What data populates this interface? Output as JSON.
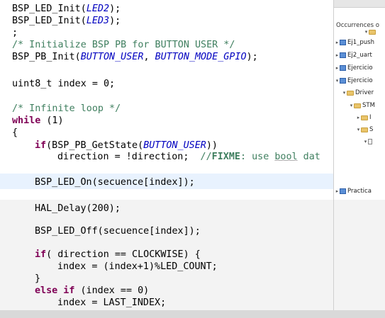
{
  "editor": {
    "lines": [
      "BSP_LED_Init(",
      "LED2",
      ");",
      "BSP_LED_Init(",
      "LED3",
      ");",
      ";",
      "/* Initialize BSP PB for BUTTON USER */",
      "BSP_PB_Init(",
      "BUTTON_USER",
      ", ",
      "BUTTON_MODE_GPIO",
      ");",
      "uint8_t index = 0;",
      "/* Infinite loop */",
      "while",
      " (1)",
      "{",
      "if",
      "(BSP_PB_GetState(",
      "BUTTON_USER",
      "))",
      "direction = !direction;  ",
      "//",
      "FIXME",
      ": use ",
      "bool",
      " dat",
      "BSP_LED_On(secuence[index]);",
      "HAL_Delay(200);",
      "BSP_LED_Off(secuence[index]);",
      "if",
      "( direction == CLOCKWISE) {",
      "index = (index+1)%LED_COUNT;",
      "}",
      "else if",
      " (index == 0)",
      "index = LAST_INDEX;"
    ]
  },
  "outline": {
    "occurrences_label": "Occurrences o",
    "items": [
      {
        "label": "Ej1_push",
        "arrow": "▸"
      },
      {
        "label": "Ej2_uart",
        "arrow": "▸"
      },
      {
        "label": "Ejercicio",
        "arrow": "▸"
      },
      {
        "label": "Ejercicio",
        "arrow": "▾"
      },
      {
        "label": "Driver",
        "arrow": "▾"
      },
      {
        "label": "STM",
        "arrow": "▾"
      },
      {
        "label": "I",
        "arrow": "▸"
      },
      {
        "label": "S",
        "arrow": "▾"
      },
      {
        "label": "",
        "arrow": "▾"
      },
      {
        "label": "Practica",
        "arrow": "▸"
      }
    ]
  }
}
